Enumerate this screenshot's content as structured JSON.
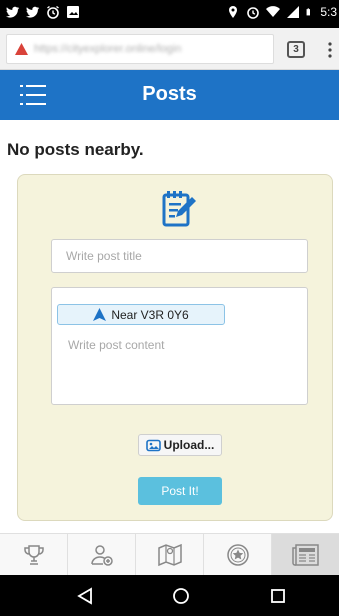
{
  "status_bar": {
    "time": "5:3",
    "icons": [
      "twitter-icon",
      "twitter-icon",
      "alarm-icon",
      "image-icon",
      "location-icon",
      "alarm-icon",
      "wifi-icon",
      "signal-icon",
      "battery-icon"
    ]
  },
  "browser": {
    "url": "https://cityexplorer.online/login",
    "tab_count": "3"
  },
  "header": {
    "title": "Posts",
    "menu_icon": "hamburger-icon"
  },
  "main": {
    "empty_message": "No posts nearby."
  },
  "composer": {
    "icon": "notepad-pen-icon",
    "title_placeholder": "Write post title",
    "location_label": "Near V3R 0Y6",
    "content_placeholder": "Write post content",
    "upload_label": "Upload...",
    "post_label": "Post It!"
  },
  "bottom_nav": {
    "items": [
      "trophy-icon",
      "add-user-icon",
      "map-icon",
      "star-badge-icon",
      "newspaper-icon"
    ],
    "active": "newspaper-icon"
  },
  "system_nav": [
    "back-icon",
    "home-icon",
    "recents-icon"
  ],
  "colors": {
    "app_bar": "#1e73c6",
    "panel": "#f5f3dc",
    "post_button": "#5bc0de",
    "location_badge": "#e6f3fb"
  }
}
